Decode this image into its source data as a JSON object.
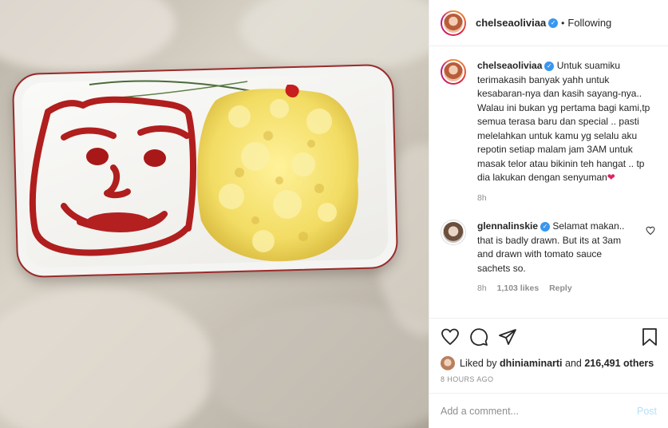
{
  "header": {
    "username": "chelseaoliviaa",
    "follow_status": "Following",
    "separator": "•"
  },
  "caption": {
    "username": "chelseaoliviaa",
    "text": "Untuk suamiku terimakasih banyak yahh untuk kesabaran-nya dan kasih sayang-nya.. Walau ini bukan yg pertama bagi kami,tp semua terasa baru dan special .. pasti melelahkan untuk kamu yg selalu aku repotin setiap malam jam 3AM untuk masak telor atau bikinin teh hangat .. tp dia lakukan dengan senyuman",
    "emoji": "❤",
    "time": "8h"
  },
  "reply": {
    "username": "glennalinskie",
    "text": "Selamat makan.. that is badly drawn. But its at 3am and drawn with tomato sauce sachets so.",
    "time": "8h",
    "likes": "1,103 likes",
    "reply_label": "Reply"
  },
  "likes": {
    "prefix": "Liked by",
    "liker": "dhiniaminarti",
    "joiner": "and",
    "others": "216,491 others"
  },
  "timestamp": "8 HOURS AGO",
  "comment_box": {
    "placeholder": "Add a comment...",
    "post_label": "Post"
  },
  "icons": {
    "verified": "verified-badge-icon",
    "like": "heart-icon",
    "comment": "comment-icon",
    "share": "share-icon",
    "save": "bookmark-icon"
  },
  "colors": {
    "verified": "#3897f0",
    "muted": "#8e8e8e",
    "post_button": "#b2dffc",
    "heart_emoji": "#e0245e"
  }
}
